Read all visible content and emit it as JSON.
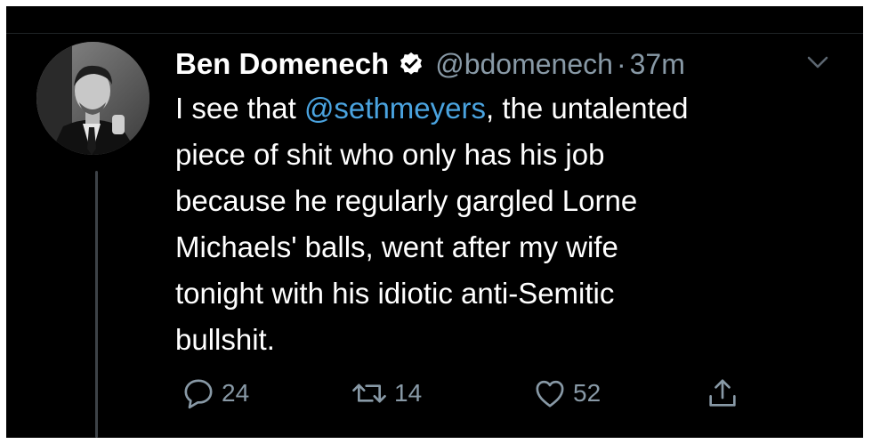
{
  "tweet": {
    "author_name": "Ben Domenech",
    "handle": "@bdomenech",
    "separator": "·",
    "time": "37m",
    "text_lines": [
      {
        "pre": "I see that ",
        "mention": "@sethmeyers",
        "post": ", the untalented"
      },
      {
        "text": "piece of shit who only has his job"
      },
      {
        "text": "because he regularly gargled Lorne"
      },
      {
        "text": "Michaels' balls, went after my wife"
      },
      {
        "text": "tonight with his idiotic anti-Semitic"
      },
      {
        "text": "bullshit."
      }
    ]
  },
  "actions": {
    "replies": "24",
    "retweets": "14",
    "likes": "52"
  },
  "icons": {
    "verified": "verified-badge-icon",
    "menu": "chevron-down-icon",
    "reply": "reply-icon",
    "retweet": "retweet-icon",
    "like": "heart-icon",
    "share": "share-icon"
  },
  "colors": {
    "background": "#000000",
    "text": "#ffffff",
    "secondary": "#8899a6",
    "mention": "#4aa3df"
  }
}
